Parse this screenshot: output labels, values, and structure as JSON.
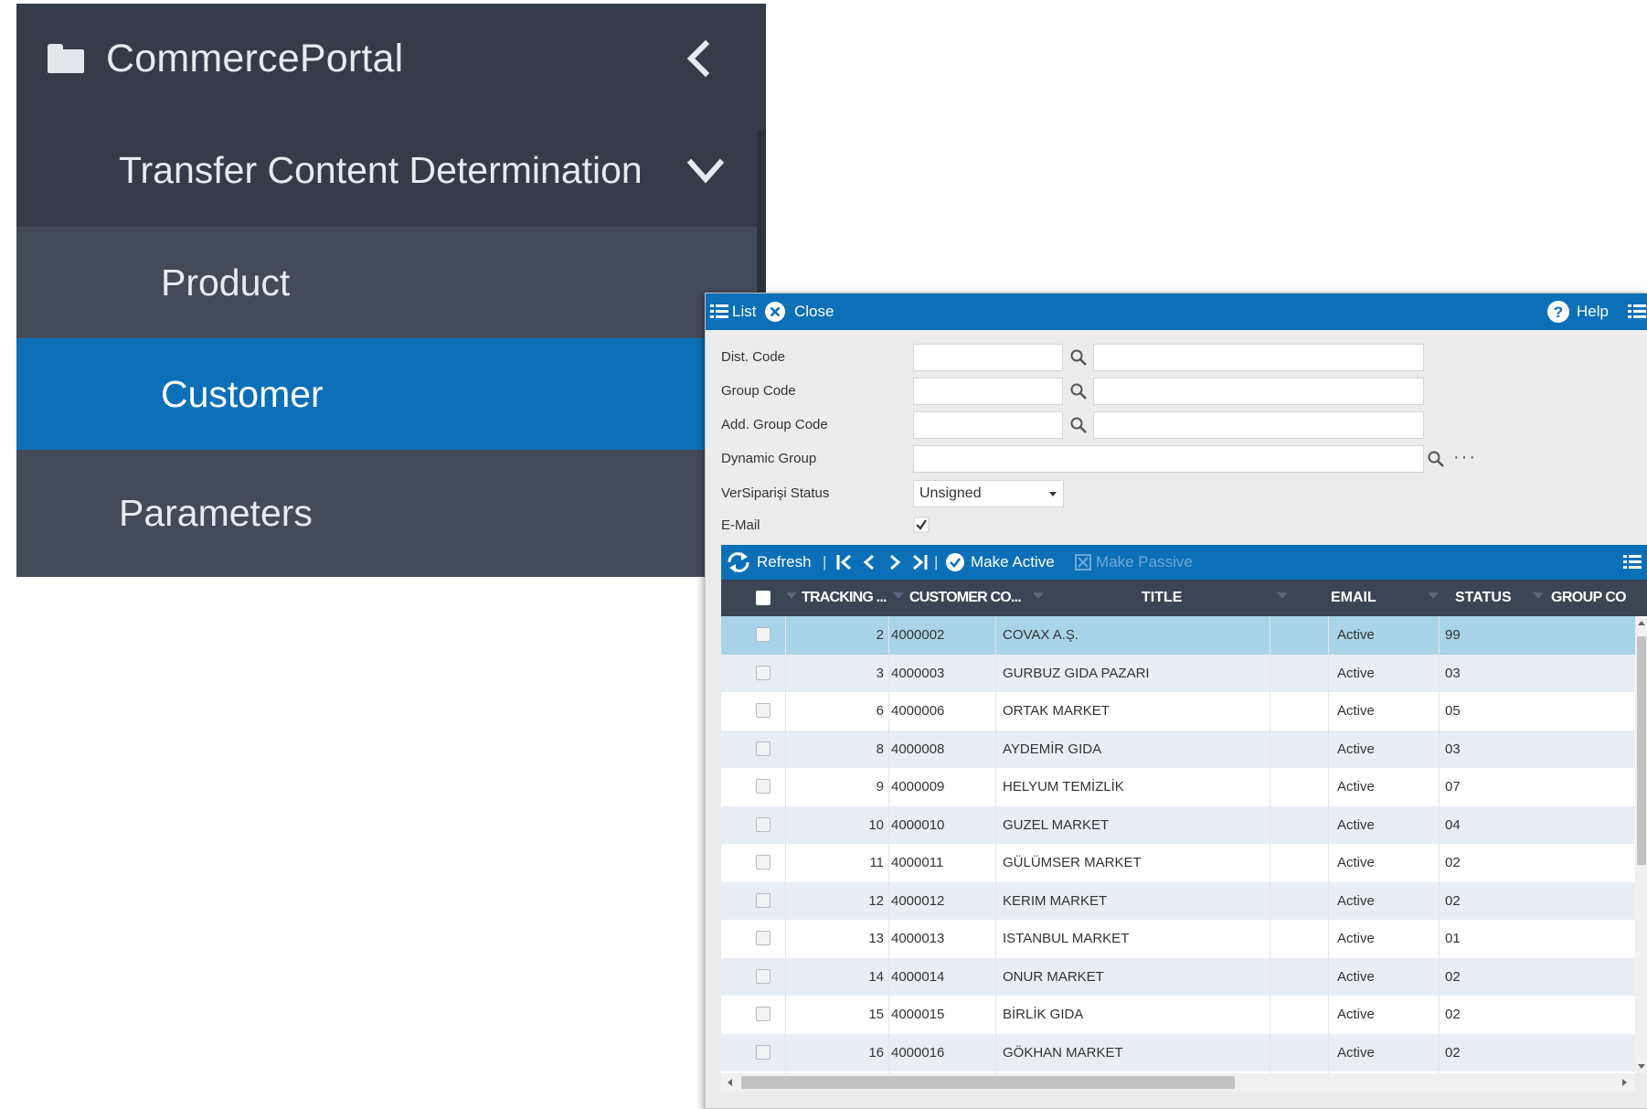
{
  "sidebar": {
    "app_title": "CommercePortal",
    "section": "Transfer Content Determination",
    "items": [
      {
        "label": "Product"
      },
      {
        "label": "Customer"
      }
    ],
    "parameters": "Parameters"
  },
  "window": {
    "list_label": "List",
    "close_label": "Close",
    "help_label": "Help"
  },
  "form": {
    "dist_code": "Dist. Code",
    "group_code": "Group Code",
    "add_group_code": "Add. Group Code",
    "dynamic_group": "Dynamic Group",
    "status_label": "VerSiparişi Status",
    "status_value": "Unsigned",
    "email_label": "E-Mail",
    "email_checked": true
  },
  "grid_toolbar": {
    "refresh": "Refresh",
    "make_active": "Make Active",
    "make_passive": "Make Passive"
  },
  "columns": {
    "tracking": "TRACKING ...",
    "customer_code": "CUSTOMER CO...",
    "title": "TITLE",
    "email": "EMAIL",
    "status": "STATUS",
    "group_code": "GROUP CO"
  },
  "rows": [
    {
      "tracking": "2",
      "code": "4000002",
      "title": "COVAX A.Ş.",
      "email": "",
      "status": "Active",
      "group": "99"
    },
    {
      "tracking": "3",
      "code": "4000003",
      "title": "GURBUZ GIDA PAZARI",
      "email": "",
      "status": "Active",
      "group": "03"
    },
    {
      "tracking": "6",
      "code": "4000006",
      "title": "ORTAK MARKET",
      "email": "",
      "status": "Active",
      "group": "05"
    },
    {
      "tracking": "8",
      "code": "4000008",
      "title": "AYDEMİR GIDA",
      "email": "",
      "status": "Active",
      "group": "03"
    },
    {
      "tracking": "9",
      "code": "4000009",
      "title": "HELYUM TEMİZLİK",
      "email": "",
      "status": "Active",
      "group": "07"
    },
    {
      "tracking": "10",
      "code": "4000010",
      "title": "GUZEL MARKET",
      "email": "",
      "status": "Active",
      "group": "04"
    },
    {
      "tracking": "11",
      "code": "4000011",
      "title": "GÜLÜMSER MARKET",
      "email": "",
      "status": "Active",
      "group": "02"
    },
    {
      "tracking": "12",
      "code": "4000012",
      "title": "KERIM MARKET",
      "email": "",
      "status": "Active",
      "group": "02"
    },
    {
      "tracking": "13",
      "code": "4000013",
      "title": "ISTANBUL MARKET",
      "email": "",
      "status": "Active",
      "group": "01"
    },
    {
      "tracking": "14",
      "code": "4000014",
      "title": "ONUR MARKET",
      "email": "",
      "status": "Active",
      "group": "02"
    },
    {
      "tracking": "15",
      "code": "4000015",
      "title": "BİRLİK GIDA",
      "email": "",
      "status": "Active",
      "group": "02"
    },
    {
      "tracking": "16",
      "code": "4000016",
      "title": "GÖKHAN MARKET",
      "email": "",
      "status": "Active",
      "group": "02"
    }
  ],
  "colors": {
    "sidebar_bg": "#353c48",
    "sidebar_item_bg": "#434b59",
    "accent": "#0b70b8",
    "grid_header": "#3b4555",
    "row_selected": "#a9d3e8",
    "row_alt": "#e9eef5"
  }
}
